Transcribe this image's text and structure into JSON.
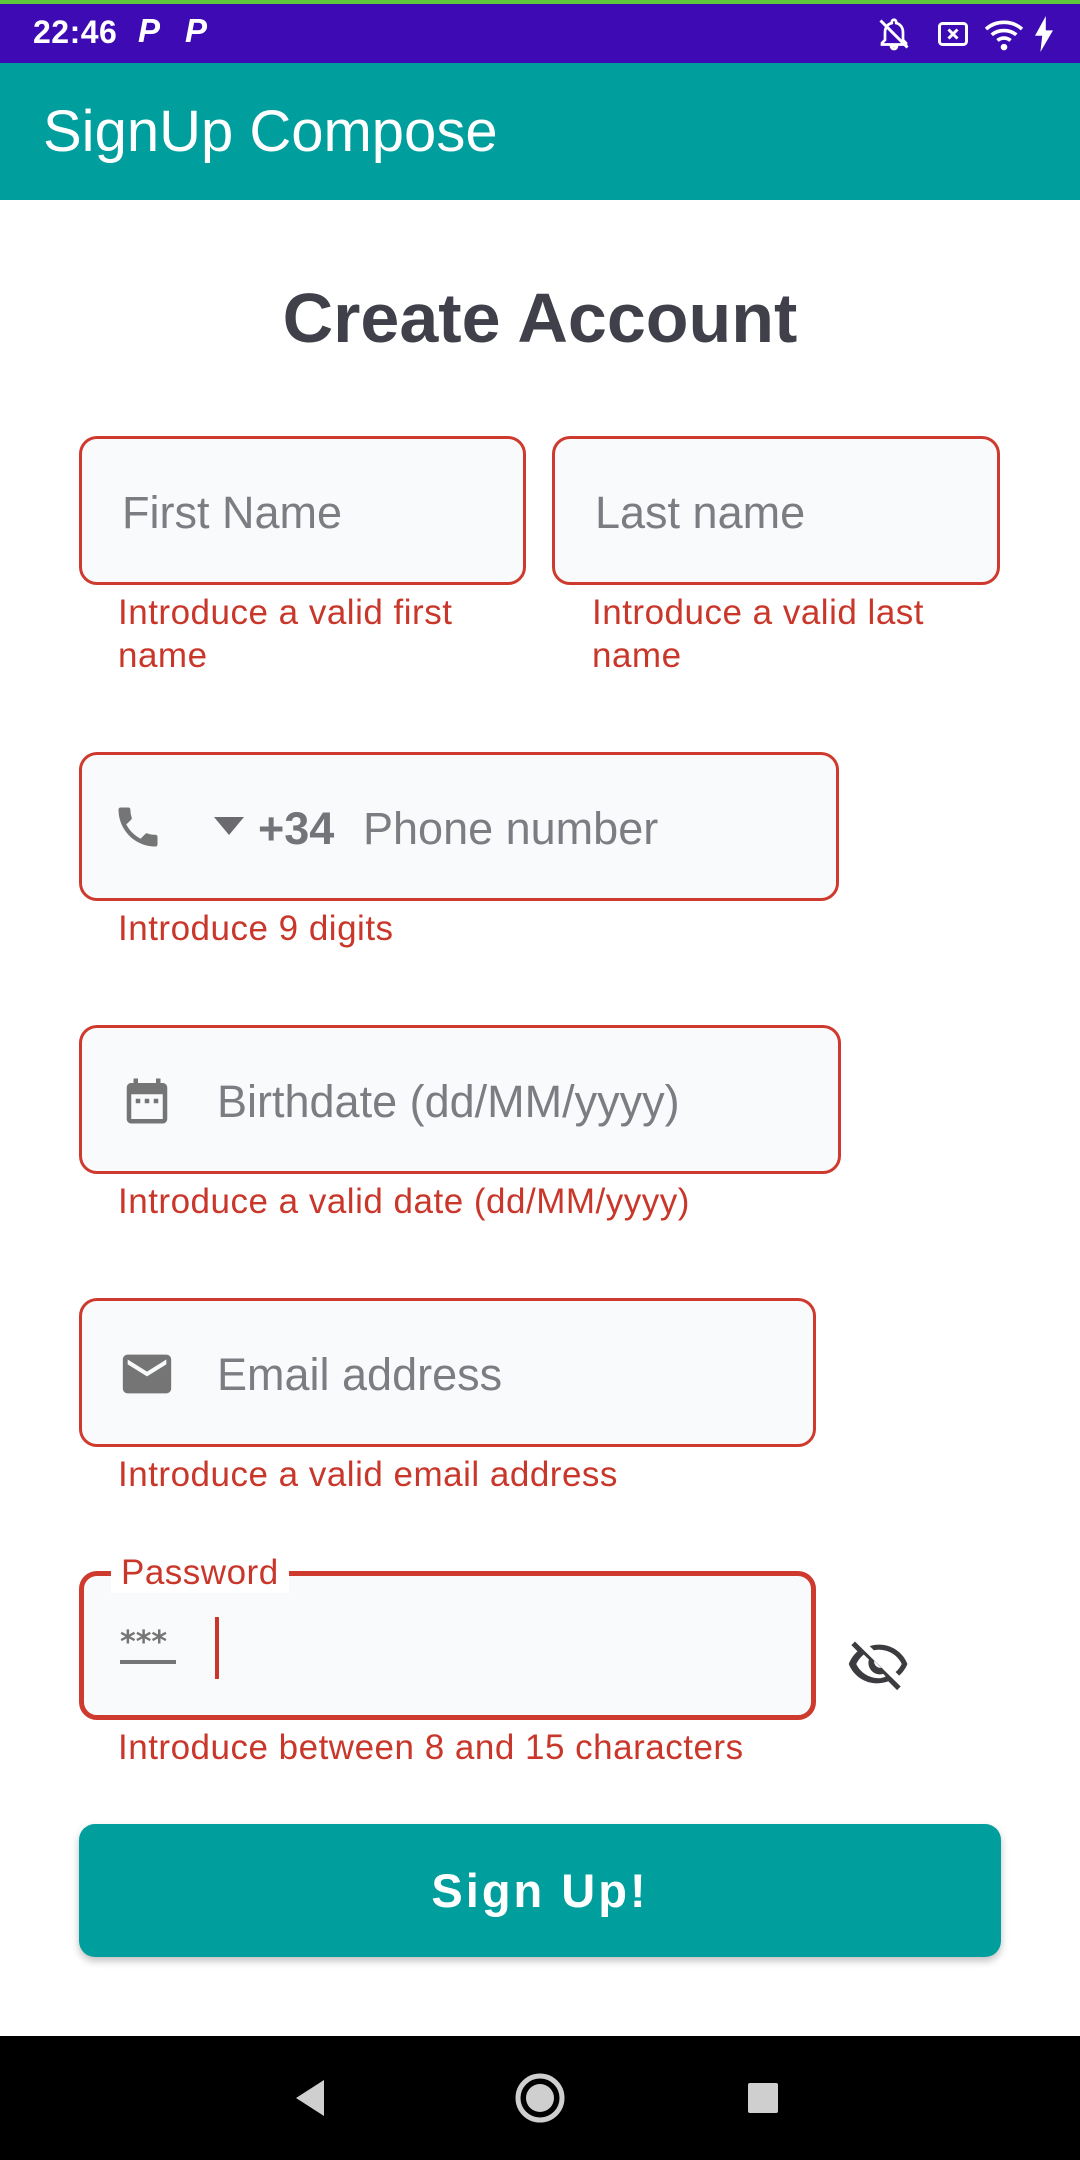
{
  "status_bar": {
    "time": "22:46",
    "notification_icons": [
      "P",
      "P"
    ],
    "icons": [
      "mute-icon",
      "sim-icon",
      "wifi-icon",
      "battery-charging-icon"
    ]
  },
  "app_bar": {
    "title": "SignUp Compose"
  },
  "form": {
    "heading": "Create Account",
    "first_name": {
      "placeholder": "First Name",
      "error": "Introduce a valid first name",
      "value": ""
    },
    "last_name": {
      "placeholder": "Last name",
      "error": "Introduce a valid last name",
      "value": ""
    },
    "phone": {
      "prefix": "+34",
      "placeholder": "Phone number",
      "error": "Introduce 9 digits",
      "value": ""
    },
    "birthdate": {
      "placeholder": "Birthdate (dd/MM/yyyy)",
      "error": "Introduce a valid date (dd/MM/yyyy)",
      "value": ""
    },
    "email": {
      "placeholder": "Email address",
      "error": "Introduce a valid email address",
      "value": ""
    },
    "password": {
      "label": "Password",
      "mask_icon_text": "***",
      "error": "Introduce between 8 and 15 characters",
      "value": ""
    },
    "submit_label": "Sign Up!"
  },
  "colors": {
    "status_bar": "#3d0ab3",
    "app_bar": "#009f9d",
    "error": "#c9372b",
    "heading": "#3f4049"
  }
}
